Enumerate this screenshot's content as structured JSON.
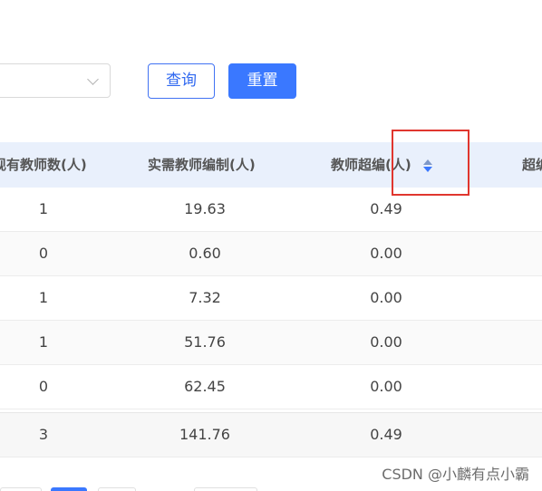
{
  "toolbar": {
    "select": {
      "value": ""
    },
    "query_label": "查询",
    "reset_label": "重置"
  },
  "table": {
    "headers": {
      "existing_teachers": "现有教师数(人)",
      "required_staffing": "实需教师编制(人)",
      "over_staffing": "教师超编(人)",
      "next_column": "超编"
    },
    "rows": [
      {
        "existing": "1",
        "required": "19.63",
        "over": "0.49"
      },
      {
        "existing": "0",
        "required": "0.60",
        "over": "0.00"
      },
      {
        "existing": "1",
        "required": "7.32",
        "over": "0.00"
      },
      {
        "existing": "1",
        "required": "51.76",
        "over": "0.00"
      },
      {
        "existing": "0",
        "required": "62.45",
        "over": "0.00"
      }
    ],
    "total": {
      "existing": "3",
      "required": "141.76",
      "over": "0.49"
    }
  },
  "watermark": "CSDN @小麟有点小霸",
  "colors": {
    "primary": "#3a78ff",
    "header_bg": "#e9f0fc",
    "highlight": "#e0362e"
  }
}
